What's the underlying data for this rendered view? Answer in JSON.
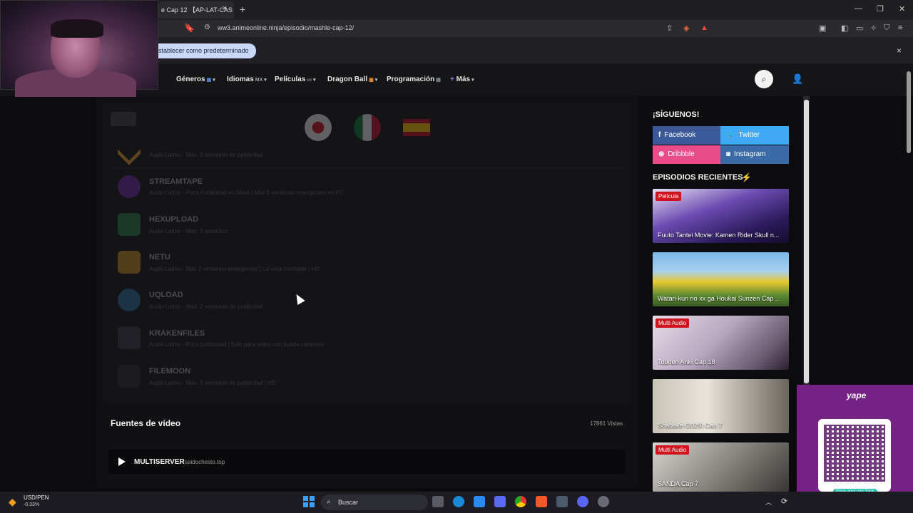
{
  "browser": {
    "tab_title": "e Cap 12 【AP-LAT-CAS",
    "tab_close": "×",
    "new_tab": "+",
    "url": "ww3.animeonline.ninja/episodio/mashle-cap-12/",
    "infobar_button": "stablecer como predeterminado",
    "infobar_close": "×",
    "window_controls": [
      "—",
      "❐",
      "✕"
    ]
  },
  "nav": {
    "items": [
      {
        "label": "Géneros",
        "extra": "▦"
      },
      {
        "label": "Idiomas",
        "extra": "MX"
      },
      {
        "label": "Películas",
        "extra": "▭"
      },
      {
        "label": "Dragon Ball",
        "extra": "▩"
      },
      {
        "label": "Programación",
        "extra": "▤"
      },
      {
        "label": "Más",
        "extra": ""
      }
    ],
    "mas_plus": "+",
    "search_icon": "⌕",
    "user_icon": "👤"
  },
  "servers": [
    {
      "name": "",
      "desc": "Audio Latino - Max. 2 ventanas de publicidad"
    },
    {
      "name": "STREAMTAPE",
      "desc": "Audio Latino - Poca Publicidad en Movil | Max 5 ventanas emergentes en PC"
    },
    {
      "name": "HEXUPLOAD",
      "desc": "Audio Latino - Max. 3 anuncios"
    },
    {
      "name": "NETU",
      "desc": "Audio Latino - Max 2 ventanas emergentes | La vieja confiable | HD"
    },
    {
      "name": "UQLOAD",
      "desc": "Audio Latino - Max. 2 ventanas de publicidad"
    },
    {
      "name": "KRAKENFILES",
      "desc": "Audio Latino - Poca publicidad | Solo para redes con buena conexion"
    },
    {
      "name": "FILEMOON",
      "desc": "Audio Latino - Max. 3 ventanas de publicidad | HD"
    }
  ],
  "player": {
    "section_title": "Fuentes de vídeo",
    "views": "17861 Vistas",
    "source_name": "MULTISERVER",
    "source_host": "saidochesto.top"
  },
  "sidebar": {
    "follow_title": "¡SÍGUENOS!",
    "social": [
      {
        "label": "Facebook",
        "icon": "f",
        "color": "#3b5998"
      },
      {
        "label": "Twitter",
        "icon": "🐦",
        "color": "#3fa9f5"
      },
      {
        "label": "Dribbble",
        "icon": "⊛",
        "color": "#ea4c89"
      },
      {
        "label": "Instagram",
        "icon": "◙",
        "color": "#3a6aa8"
      }
    ],
    "recent_title": "EPISODIOS RECIENTES",
    "recent_icon": "⚡",
    "episodes": [
      {
        "badge": "Película",
        "title": "Fuuto Tantei Movie: Kamen Rider Skull n..."
      },
      {
        "badge": "",
        "title": "Watari-kun no xx ga Houkai Sunzen Cap ..."
      },
      {
        "badge": "Multi Audio",
        "title": "Tougen Anki Cap 18"
      },
      {
        "badge": "",
        "title": "Shabake (2025) Cap 7"
      },
      {
        "badge": "Multi Audio",
        "title": "SANDA Cap 7"
      }
    ]
  },
  "yape": {
    "logo": "yape",
    "caption": "Paga aquí con Yape"
  },
  "taskbar": {
    "ticker_name": "USD/PEN",
    "ticker_change": "-0.33%",
    "search_placeholder": "Buscar"
  }
}
